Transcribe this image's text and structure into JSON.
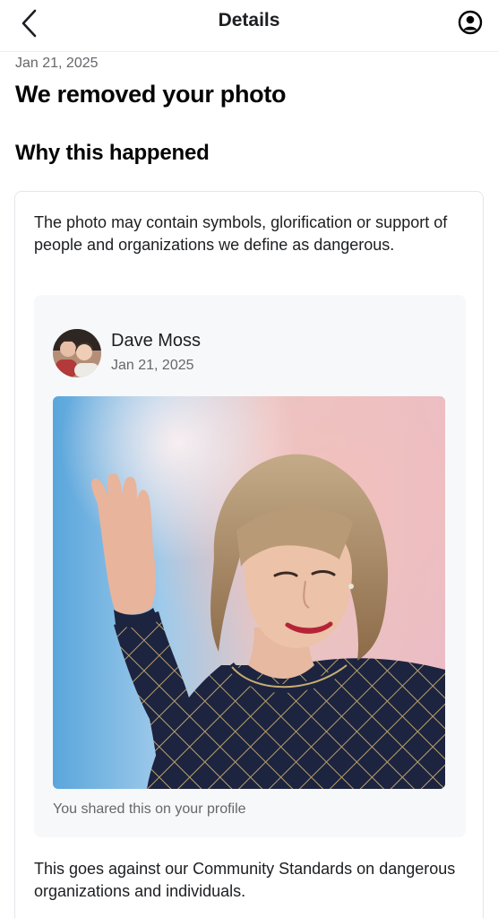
{
  "header": {
    "title": "Details",
    "back_icon": "chevron-left-icon",
    "account_icon": "user-circle-icon"
  },
  "notice": {
    "date": "Jan 21, 2025",
    "headline": "We removed your photo",
    "why_heading": "Why this happened",
    "reason": "The photo may contain symbols, glorification or support of people and organizations we define as dangerous."
  },
  "post": {
    "author": "Dave Moss",
    "date": "Jan 21, 2025",
    "shared_note": "You shared this on your profile"
  },
  "footer": {
    "standards": "This goes against our Community Standards on dangerous organizations and individuals."
  },
  "colors": {
    "text_primary": "#1c1e21",
    "text_secondary": "#65676b",
    "border": "#e4e6eb",
    "post_bg": "#f7f8fa"
  }
}
